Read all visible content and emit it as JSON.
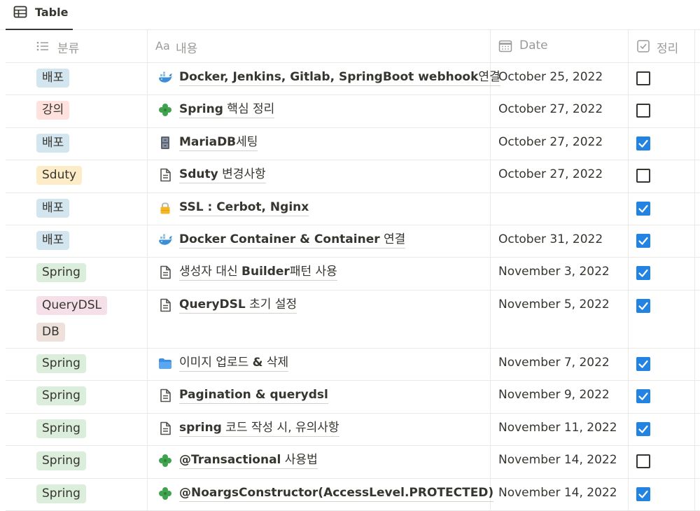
{
  "view": {
    "tab_label": "Table",
    "tab_icon": "table-icon"
  },
  "columns": [
    {
      "label": "분류",
      "icon": "list-icon"
    },
    {
      "label": "내용",
      "icon": "text-aa-icon",
      "icon_text": "Aa"
    },
    {
      "label": "Date",
      "icon": "calendar-icon"
    },
    {
      "label": "정리",
      "icon": "checkbox-icon"
    }
  ],
  "tag_colors": {
    "배포": "#d3e5ef",
    "강의": "#ffe2dd",
    "Sduty": "#fdecc8",
    "Spring": "#dbeddb",
    "QueryDSL": "#f5e0e9",
    "DB": "#eee0da"
  },
  "accent": "#2383e2",
  "rows": [
    {
      "tags": [
        "배포"
      ],
      "icon": "whale-icon",
      "title": [
        {
          "t": "Docker, Jenkins, Gitlab, SpringBoot webhook",
          "b": true
        },
        {
          "t": "연결",
          "b": false
        }
      ],
      "date": "October 25, 2022",
      "done": false
    },
    {
      "tags": [
        "강의"
      ],
      "icon": "clover-icon",
      "title": [
        {
          "t": "Spring",
          "b": true
        },
        {
          "t": " 핵심 정리",
          "b": false
        }
      ],
      "date": "October 27, 2022",
      "done": false
    },
    {
      "tags": [
        "배포"
      ],
      "icon": "file-cabinet-icon",
      "title": [
        {
          "t": "MariaDB",
          "b": true
        },
        {
          "t": "세팅",
          "b": false
        }
      ],
      "date": "October 27, 2022",
      "done": true
    },
    {
      "tags": [
        "Sduty"
      ],
      "icon": "page-icon",
      "title": [
        {
          "t": "Sduty",
          "b": true
        },
        {
          "t": " 변경사항",
          "b": false
        }
      ],
      "date": "October 27, 2022",
      "done": false
    },
    {
      "tags": [
        "배포"
      ],
      "icon": "lock-icon",
      "title": [
        {
          "t": "SSL : Cerbot, Nginx",
          "b": true
        }
      ],
      "date": "",
      "done": true
    },
    {
      "tags": [
        "배포"
      ],
      "icon": "whale-icon",
      "title": [
        {
          "t": "Docker Container & Container",
          "b": true
        },
        {
          "t": " 연결",
          "b": false
        }
      ],
      "date": "October 31, 2022",
      "done": true
    },
    {
      "tags": [
        "Spring"
      ],
      "icon": "page-icon",
      "title": [
        {
          "t": "생성자 대신 ",
          "b": false
        },
        {
          "t": "Builder",
          "b": true
        },
        {
          "t": "패턴 사용",
          "b": false
        }
      ],
      "date": "November 3, 2022",
      "done": true
    },
    {
      "tags": [
        "QueryDSL",
        "DB"
      ],
      "icon": "page-icon",
      "title": [
        {
          "t": "QueryDSL",
          "b": true
        },
        {
          "t": " 초기 설정",
          "b": false
        }
      ],
      "date": "November 5, 2022",
      "done": true
    },
    {
      "tags": [
        "Spring"
      ],
      "icon": "folder-icon",
      "title": [
        {
          "t": "이미지 업로드 ",
          "b": false
        },
        {
          "t": "&",
          "b": true
        },
        {
          "t": " 삭제",
          "b": false
        }
      ],
      "date": "November 7, 2022",
      "done": true
    },
    {
      "tags": [
        "Spring"
      ],
      "icon": "page-icon",
      "title": [
        {
          "t": "Pagination & querydsl",
          "b": true
        }
      ],
      "date": "November 9, 2022",
      "done": true
    },
    {
      "tags": [
        "Spring"
      ],
      "icon": "page-icon",
      "title": [
        {
          "t": "spring",
          "b": true
        },
        {
          "t": " 코드 작성 시, 유의사항",
          "b": false
        }
      ],
      "date": "November 11, 2022",
      "done": true
    },
    {
      "tags": [
        "Spring"
      ],
      "icon": "clover-icon",
      "title": [
        {
          "t": "@Transactional",
          "b": true
        },
        {
          "t": " 사용법",
          "b": false
        }
      ],
      "date": "November 14, 2022",
      "done": false
    },
    {
      "tags": [
        "Spring"
      ],
      "icon": "clover-icon",
      "title": [
        {
          "t": "@NoargsConstructor(AccessLevel.PROTECTED)",
          "b": true
        }
      ],
      "date": "November 14, 2022",
      "done": true
    }
  ]
}
